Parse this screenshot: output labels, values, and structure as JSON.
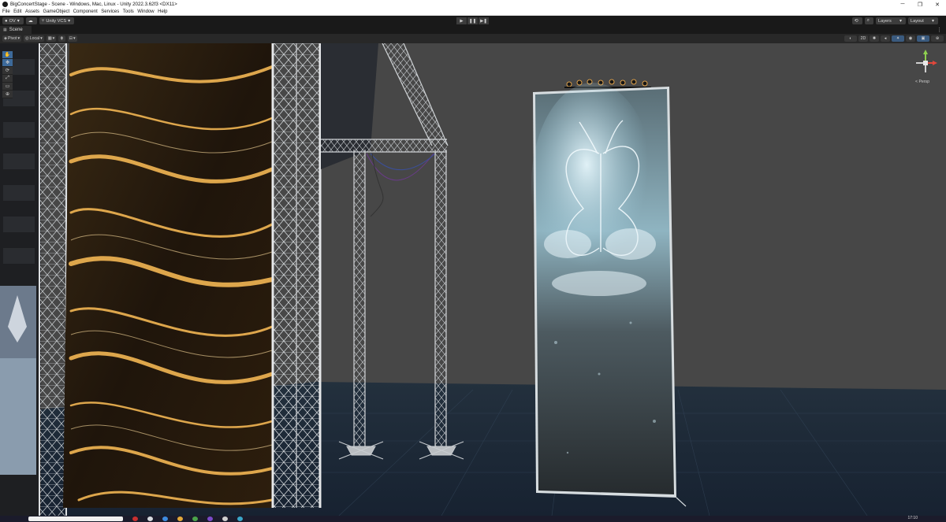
{
  "window": {
    "title": "BigConcertStage - Scene - Windows, Mac, Linux - Unity 2022.3.62f3 <DX11>",
    "controls": {
      "minimize": "─",
      "maximize": "❐",
      "close": "✕"
    }
  },
  "menu": [
    "File",
    "Edit",
    "Assets",
    "GameObject",
    "Component",
    "Services",
    "Tools",
    "Window",
    "Help"
  ],
  "toolbar": {
    "account_label": "OV",
    "version_control_label": "Unity VCS",
    "layers_label": "Layers",
    "layout_label": "Layout",
    "play_icons": {
      "play": "▶",
      "pause": "❚❚",
      "step": "▶❚"
    }
  },
  "scene_tab": {
    "label": "Scene"
  },
  "scene_toolbar": {
    "pivot_label": "Pivot",
    "space_label": "Local",
    "mode_2d_label": "2D"
  },
  "scene": {
    "gizmo_label": "< Persp",
    "colors": {
      "viewport": "#464646",
      "floor": "#1c2a3c",
      "truss": "#d6d9dc",
      "gold": "#e7a743",
      "screen_ice": "#a9d4e4"
    }
  },
  "taskbar": {
    "clock": "17:10"
  },
  "icons": {
    "tools": [
      "hand-icon",
      "move-icon",
      "rotate-icon",
      "scale-icon",
      "rect-icon",
      "transform-icon"
    ],
    "tool_glyphs": [
      "✋",
      "✥",
      "⟳",
      "⤢",
      "▭",
      "⊕"
    ]
  }
}
